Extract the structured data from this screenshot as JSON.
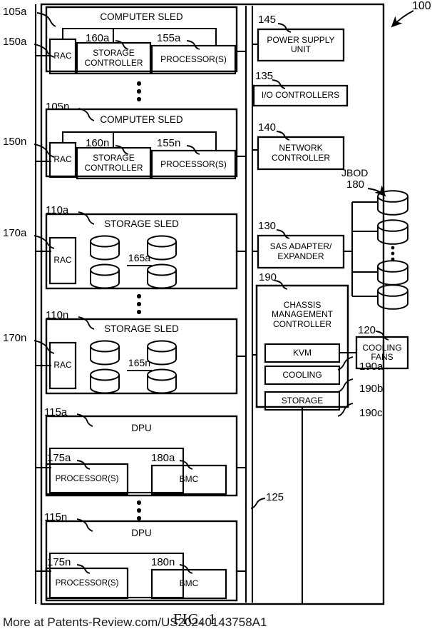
{
  "figure": {
    "caption": "FIG. 1",
    "system_ref": "100",
    "footer": "More at Patents-Review.com/US20240143758A1"
  },
  "chassis": {
    "bus_ref": "125"
  },
  "computer_sleds": [
    {
      "ref": "105a",
      "title": "COMPUTER SLED",
      "rac": {
        "ref": "150a",
        "label": "RAC"
      },
      "storage_controller": {
        "ref": "160a",
        "label": "STORAGE CONTROLLER"
      },
      "processors": {
        "ref": "155a",
        "label": "PROCESSOR(S)"
      }
    },
    {
      "ref": "105n",
      "title": "COMPUTER SLED",
      "rac": {
        "ref": "150n",
        "label": "RAC"
      },
      "storage_controller": {
        "ref": "160n",
        "label": "STORAGE CONTROLLER"
      },
      "processors": {
        "ref": "155n",
        "label": "PROCESSOR(S)"
      }
    }
  ],
  "storage_sleds": [
    {
      "ref": "110a",
      "title": "STORAGE SLED",
      "rac": {
        "ref": "170a",
        "label": "RAC"
      },
      "drives_ref": "165a",
      "drive_count": 4
    },
    {
      "ref": "110n",
      "title": "STORAGE SLED",
      "rac": {
        "ref": "170n",
        "label": "RAC"
      },
      "drives_ref": "165n",
      "drive_count": 4
    }
  ],
  "dpus": [
    {
      "ref": "115a",
      "title": "DPU",
      "processors": {
        "ref": "175a",
        "label": "PROCESSOR(S)"
      },
      "bmc": {
        "ref": "180a",
        "label": "BMC"
      }
    },
    {
      "ref": "115n",
      "title": "DPU",
      "processors": {
        "ref": "175n",
        "label": "PROCESSOR(S)"
      },
      "bmc": {
        "ref": "180n",
        "label": "BMC"
      }
    }
  ],
  "right_column": {
    "power_supply": {
      "ref": "145",
      "label": "POWER SUPPLY UNIT"
    },
    "io_controllers": {
      "ref": "135",
      "label": "I/O CONTROLLERS"
    },
    "network_controller": {
      "ref": "140",
      "label": "NETWORK CONTROLLER"
    },
    "sas_adapter": {
      "ref": "130",
      "label": "SAS ADAPTER/ EXPANDER"
    },
    "chassis_management_controller": {
      "ref": "190",
      "label": "CHASSIS MANAGEMENT CONTROLLER",
      "modules": [
        {
          "ref": "190a",
          "label": "KVM"
        },
        {
          "ref": "190b",
          "label": "COOLING"
        },
        {
          "ref": "190c",
          "label": "STORAGE"
        }
      ]
    },
    "cooling_fans": {
      "ref": "120",
      "label": "COOLING FANS"
    }
  },
  "jbod": {
    "title": "JBOD",
    "ref": "180",
    "disk_count": 4
  }
}
